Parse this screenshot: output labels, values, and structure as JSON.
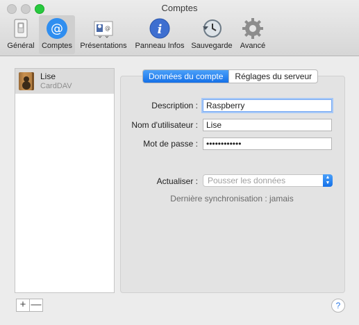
{
  "window": {
    "title": "Comptes"
  },
  "toolbar": {
    "items": [
      {
        "label": "Général",
        "icon": "general-switch-icon"
      },
      {
        "label": "Comptes",
        "icon": "at-sign-icon",
        "selected": true
      },
      {
        "label": "Présentations",
        "icon": "vcard-template-icon"
      },
      {
        "label": "Panneau Infos",
        "icon": "info-icon"
      },
      {
        "label": "Sauvegarde",
        "icon": "time-machine-backup-icon"
      },
      {
        "label": "Avancé",
        "icon": "gear-icon"
      }
    ]
  },
  "accounts": [
    {
      "name": "Lise",
      "type": "CardDAV",
      "icon": "address-book-icon"
    }
  ],
  "list_controls": {
    "add": "+",
    "remove": "—"
  },
  "tabs": [
    {
      "label": "Données du compte",
      "active": true
    },
    {
      "label": "Réglages du serveur",
      "active": false
    }
  ],
  "form": {
    "description_label": "Description :",
    "description_value": "Raspberry",
    "username_label": "Nom d'utilisateur :",
    "username_value": "Lise",
    "password_label": "Mot de passe :",
    "password_value": "••••••••••••",
    "refresh_label": "Actualiser :",
    "refresh_value": "Pousser les données",
    "last_sync": "Dernière synchronisation : jamais"
  },
  "help": "?",
  "colors": {
    "accent": "#1470e8",
    "focus_ring": "#a6c8f7"
  }
}
